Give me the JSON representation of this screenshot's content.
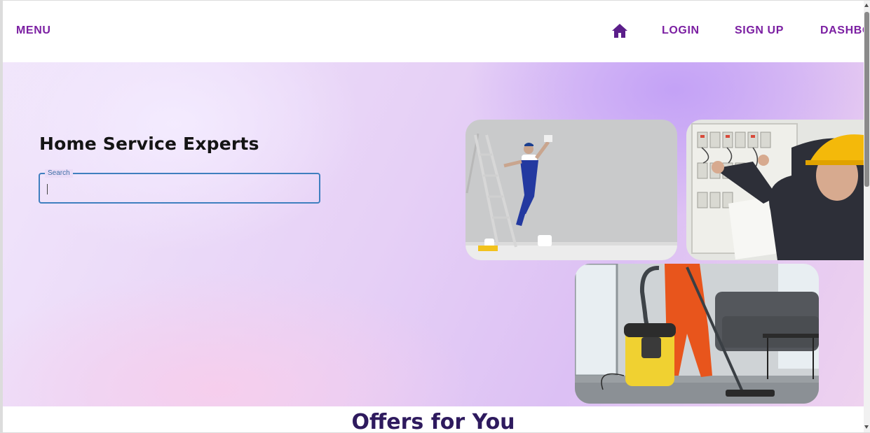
{
  "nav": {
    "menu_label": "MENU",
    "home_icon": "home-icon",
    "login_label": "LOGIN",
    "signup_label": "SIGN UP",
    "dashboard_label": "DASHBOARD"
  },
  "hero": {
    "title": "Home Service Experts",
    "search": {
      "label": "Search",
      "value": "",
      "placeholder": ""
    },
    "images": [
      "painter-photo",
      "electrician-photo",
      "cleaner-photo"
    ]
  },
  "offers": {
    "title": "Offers for You"
  },
  "colors": {
    "accent": "#7b1fa2",
    "title_dark": "#2e1a5e",
    "search_border": "#3f7fbf"
  }
}
